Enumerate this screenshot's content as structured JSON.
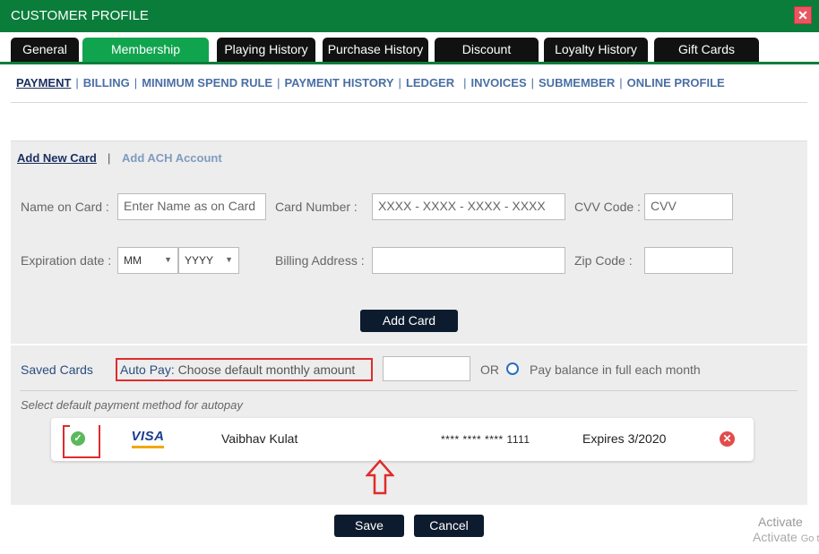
{
  "window": {
    "title": "CUSTOMER PROFILE",
    "close_glyph": "✕"
  },
  "tabs": [
    {
      "label": "General"
    },
    {
      "label": "Membership"
    },
    {
      "label": "Playing History"
    },
    {
      "label": "Purchase History"
    },
    {
      "label": "Discount"
    },
    {
      "label": "Loyalty History"
    },
    {
      "label": "Gift Cards"
    }
  ],
  "subnav": {
    "items": [
      "PAYMENT",
      "BILLING",
      "MINIMUM SPEND RULE",
      "PAYMENT HISTORY",
      "LEDGER",
      "INVOICES",
      "SUBMEMBER",
      "ONLINE PROFILE"
    ],
    "separator": "|"
  },
  "card_form": {
    "add_card_link": "Add New Card",
    "link_separator": "|",
    "add_ach_link": "Add ACH Account",
    "name_label": "Name on Card :",
    "name_placeholder": "Enter Name as on Card",
    "number_label": "Card Number :",
    "number_placeholder": "XXXX - XXXX - XXXX - XXXX",
    "cvv_label": "CVV Code :",
    "cvv_placeholder": "CVV",
    "expiration_label": "Expiration date :",
    "month_value": "MM",
    "year_value": "YYYY",
    "billing_label": "Billing Address :",
    "billing_value": "",
    "zip_label": "Zip Code :",
    "zip_value": "",
    "add_button": "Add Card"
  },
  "saved_cards": {
    "title": "Saved Cards",
    "autopay_label": "Auto Pay:",
    "autopay_text": "Choose default monthly amount",
    "autopay_amount": "",
    "or_text": "OR",
    "pay_balance_text": "Pay balance in full each month",
    "hint": "Select default payment method for autopay",
    "cards": [
      {
        "brand": "VISA",
        "holder": "Vaibhav Kulat",
        "number": "**** **** **** 1111",
        "expires": "Expires 3/2020"
      }
    ]
  },
  "footer": {
    "save_button": "Save",
    "cancel_button": "Cancel"
  },
  "watermark": {
    "line1": "Activate",
    "line2": "Activate",
    "line2_small": "Go to Set"
  },
  "colors": {
    "brand_green": "#0b7d3b",
    "active_tab": "#11a44f",
    "button_dark": "#0d1b2e",
    "highlight_red": "#e02b2b"
  },
  "icons": {
    "close": "close-icon",
    "check": "check-circle-icon",
    "delete": "delete-circle-icon",
    "arrow": "up-arrow-annotation-icon",
    "radio": "radio-icon"
  }
}
